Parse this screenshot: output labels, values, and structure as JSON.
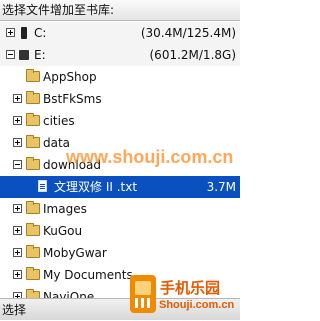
{
  "header": {
    "title": "选择文件增加至书库:"
  },
  "drives": [
    {
      "label": "C:",
      "size": "(30.4M/125.4M)"
    },
    {
      "label": "E:",
      "size": "(601.2M/1.8G)"
    }
  ],
  "folders": [
    {
      "label": "AppShop"
    },
    {
      "label": "BstFkSms"
    },
    {
      "label": "cities"
    },
    {
      "label": "data"
    },
    {
      "label": "download"
    },
    {
      "label": "Images"
    },
    {
      "label": "KuGou"
    },
    {
      "label": "MobyGwar"
    },
    {
      "label": "My Documents"
    },
    {
      "label": "NaviOne"
    }
  ],
  "selected_file": {
    "label": "文理双修 II .txt",
    "size": "3.7M"
  },
  "footer": {
    "select_label": "选择"
  },
  "watermark": "www.shouji.com.cn",
  "logo": {
    "name": "手机乐园",
    "url": "Shouji.com.cn"
  },
  "colors": {
    "selection": "#0a50c0",
    "watermark": "#ff7800"
  }
}
